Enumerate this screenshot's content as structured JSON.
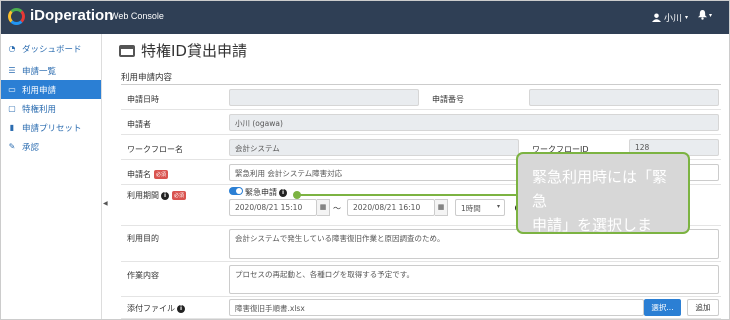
{
  "header": {
    "brand": "iDoperation",
    "brand_sub": "Web Console",
    "user_name": "小川"
  },
  "sidebar": {
    "items": [
      {
        "label": "ダッシュボード",
        "icon": "dashboard-icon"
      },
      {
        "label": "申請一覧",
        "icon": "list-icon"
      },
      {
        "label": "利用申請",
        "icon": "inbox-icon"
      },
      {
        "label": "特権利用",
        "icon": "monitor-icon"
      },
      {
        "label": "申請プリセット",
        "icon": "bookmark-icon"
      },
      {
        "label": "承認",
        "icon": "edit-icon"
      }
    ],
    "active_index": 2
  },
  "page": {
    "title": "特権ID貸出申請",
    "section": "利用申請内容"
  },
  "form": {
    "apply_date_label": "申請日時",
    "apply_date_value": "",
    "apply_no_label": "申請番号",
    "apply_no_value": "",
    "applicant_label": "申請者",
    "applicant_value": "小川 (ogawa)",
    "workflow_name_label": "ワークフロー名",
    "workflow_name_value": "会計システム",
    "workflow_id_label": "ワークフローID",
    "workflow_id_value": "128",
    "apply_name_label": "申請名",
    "apply_name_value": "緊急利用 会計システム障害対応",
    "period_label": "利用期間",
    "emergency_label": "緊急申請",
    "start_value": "2020/08/21 15:10",
    "tilde": "〜",
    "end_value": "2020/08/21 16:10",
    "duration_value": "1時間",
    "purpose_label": "利用目的",
    "purpose_value": "会計システムで発生している障害復旧作業と原因調査のため。",
    "work_label": "作業内容",
    "work_value": "プロセスの再起動と、各種ログを取得する予定です。",
    "attach_label": "添付ファイル",
    "attach_value": "障害復旧手順書.xlsx",
    "select_button": "選択...",
    "add_button": "追加",
    "required_badge": "必須"
  },
  "callout": {
    "line1": "緊急利用時には「緊急",
    "line2": "申請」を選択します。"
  },
  "colors": {
    "header_bg": "#2f3f55",
    "accent": "#2b7fd4",
    "callout_border": "#7cb342",
    "required": "#d9534f"
  }
}
